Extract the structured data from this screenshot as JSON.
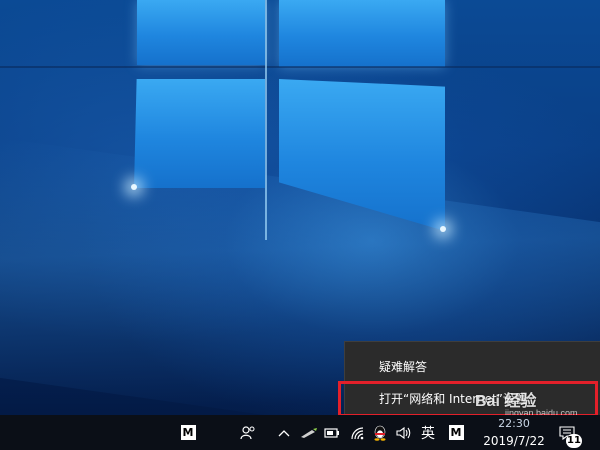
{
  "context_menu": {
    "items": [
      {
        "label": "疑难解答"
      },
      {
        "label": "打开“网络和 Internet”设置"
      }
    ]
  },
  "taskbar": {
    "app_badge_label": "M",
    "tray": {
      "language_label": "英",
      "ime_badge_label": "M",
      "time": "22:30",
      "date": "2019/7/22",
      "notification_count": "11"
    }
  },
  "watermark": {
    "brand": "Bai 经验",
    "url": "jingyan.baidu.com"
  },
  "colors": {
    "menu_bg": "#2b2b2b",
    "highlight": "#e3202a",
    "taskbar_bg": "#0b0f17"
  }
}
